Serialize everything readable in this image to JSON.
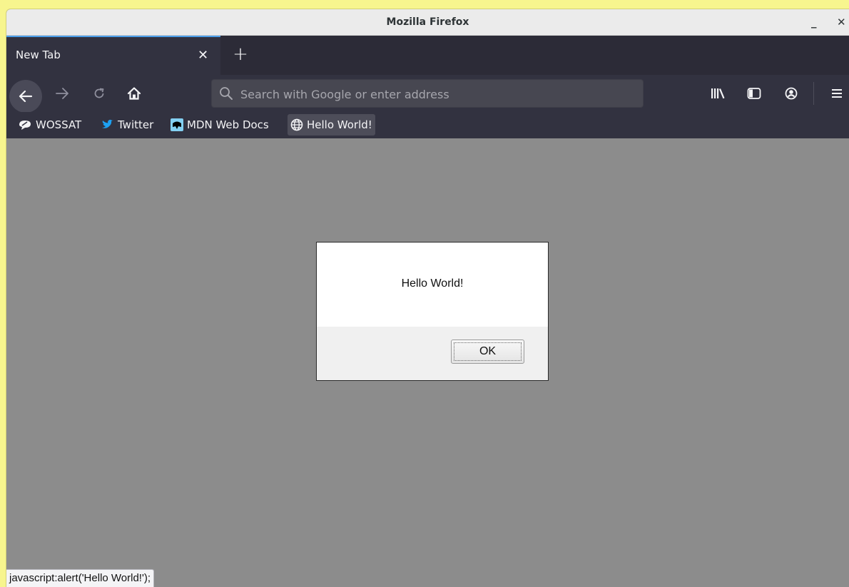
{
  "window": {
    "title": "Mozilla Firefox",
    "minimize_label": "_",
    "close_label": "✕"
  },
  "tabs": [
    {
      "label": "New Tab",
      "close_label": "✕"
    }
  ],
  "new_tab_label": "+",
  "urlbar": {
    "placeholder": "Search with Google or enter address",
    "value": ""
  },
  "bookmarks": [
    {
      "label": "WOSSAT",
      "icon": "speech-bubble-icon"
    },
    {
      "label": "Twitter",
      "icon": "twitter-bird-icon"
    },
    {
      "label": "MDN Web Docs",
      "icon": "mdn-dino-icon"
    },
    {
      "label": "Hello World!",
      "icon": "globe-icon"
    }
  ],
  "dialog": {
    "message": "Hello World!",
    "ok_label": "OK"
  },
  "status": {
    "text": "javascript:alert('Hello World!');"
  },
  "colors": {
    "accent": "#4a9eea",
    "toolbar": "#323240",
    "tabbar": "#2c2b37",
    "content_overlay": "#8c8c8c"
  }
}
